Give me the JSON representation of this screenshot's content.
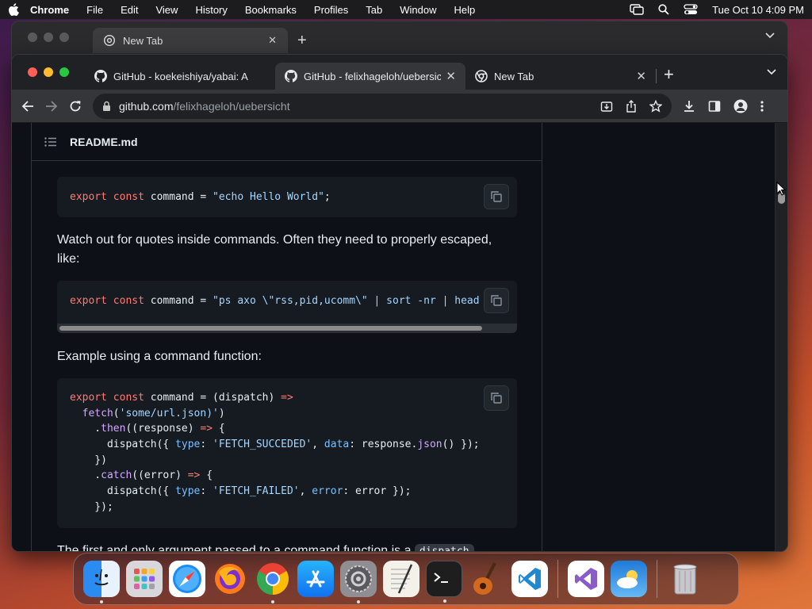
{
  "menubar": {
    "app_name": "Chrome",
    "menus": [
      "File",
      "Edit",
      "View",
      "History",
      "Bookmarks",
      "Profiles",
      "Tab",
      "Window",
      "Help"
    ],
    "datetime": "Tue Oct 10  4:09 PM"
  },
  "back_window": {
    "tab_label": "New Tab"
  },
  "browser": {
    "tabs": [
      {
        "label": "GitHub - koekeishiya/yabai: A",
        "icon": "github-icon",
        "active": false
      },
      {
        "label": "GitHub - felixhageloh/uebersic",
        "icon": "github-icon",
        "active": true
      },
      {
        "label": "New Tab",
        "icon": "chrome-icon",
        "active": false
      }
    ],
    "url_host": "github.com",
    "url_path": "/felixhageloh/uebersicht"
  },
  "readme": {
    "filename": "README.md",
    "code1": "export const command = \"echo Hello World\";",
    "para1": "Watch out for quotes inside commands. Often they need to properly escaped, like:",
    "code2": "export const command = \"ps axo \\\"rss,pid,ucomm\\\" | sort -nr | head -n",
    "para2": "Example using a command function:",
    "code3_lines": [
      "export const command = (dispatch) =>",
      "  fetch('some/url.json)')",
      "    .then((response) => {",
      "      dispatch({ type: 'FETCH_SUCCEDED', data: response.json() });",
      "    })",
      "    .catch((error) => {",
      "      dispatch({ type: 'FETCH_FAILED', error: error });",
      "    });"
    ],
    "para3_text": "The first and only argument passed to a command function is a ",
    "para3_code": "dispatch"
  },
  "dock": {
    "apps": [
      "finder-icon",
      "launchpad-icon",
      "safari-icon",
      "firefox-icon",
      "chrome-icon",
      "app-store-icon",
      "system-settings-icon",
      "textedit-icon",
      "terminal-icon",
      "garageband-icon",
      "vscode-icon",
      "visual-studio-icon",
      "weather-icon",
      "trash-icon"
    ]
  },
  "colors": {
    "page_bg": "#0d1117",
    "code_bg": "#161b22",
    "keyword": "#ff7b72",
    "string": "#a5d6ff",
    "function": "#d2a8ff",
    "property": "#79c0ff"
  }
}
